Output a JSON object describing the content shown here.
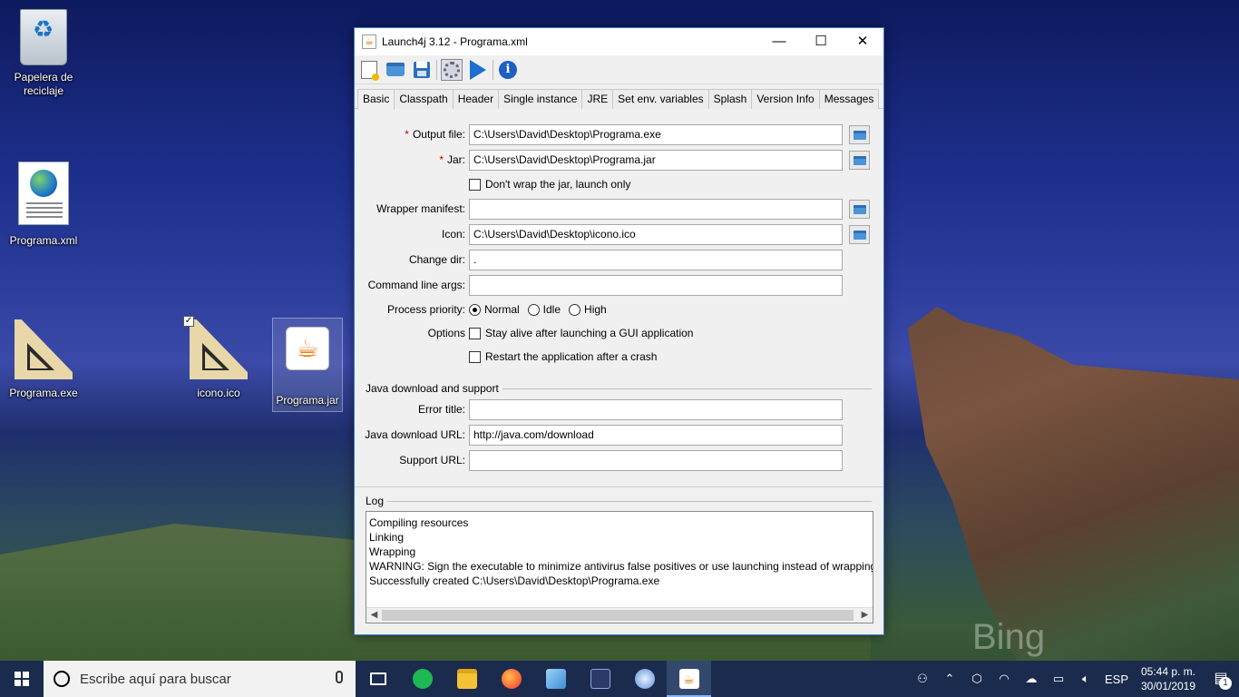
{
  "desktop": {
    "icons": [
      {
        "label": "Papelera de reciclaje"
      },
      {
        "label": "Programa.xml"
      },
      {
        "label": "Programa.exe"
      },
      {
        "label": "icono.ico"
      },
      {
        "label": "Programa.jar"
      }
    ],
    "watermark": "Bing"
  },
  "window": {
    "title": "Launch4j 3.12 - Programa.xml",
    "controls": {
      "minimize": "—",
      "maximize": "☐",
      "close": "✕"
    },
    "toolbar": [
      "new-icon",
      "open-icon",
      "save-icon",
      "build-gear-icon",
      "run-icon",
      "info-icon"
    ],
    "tabs": [
      "Basic",
      "Classpath",
      "Header",
      "Single instance",
      "JRE",
      "Set env. variables",
      "Splash",
      "Version Info",
      "Messages"
    ],
    "active_tab": "Basic",
    "form": {
      "output_file": {
        "label": "Output file:",
        "value": "C:\\Users\\David\\Desktop\\Programa.exe",
        "required": "*"
      },
      "jar": {
        "label": "Jar:",
        "value": "C:\\Users\\David\\Desktop\\Programa.jar",
        "required": "*"
      },
      "dont_wrap": {
        "label": "Don't wrap the jar, launch only"
      },
      "wrapper_manifest": {
        "label": "Wrapper manifest:",
        "value": ""
      },
      "icon": {
        "label": "Icon:",
        "value": "C:\\Users\\David\\Desktop\\icono.ico"
      },
      "change_dir": {
        "label": "Change dir:",
        "value": "."
      },
      "cmd_args": {
        "label": "Command line args:",
        "value": ""
      },
      "priority": {
        "label": "Process priority:",
        "options": [
          "Normal",
          "Idle",
          "High"
        ],
        "selected": "Normal"
      },
      "options": {
        "label": "Options",
        "stay_alive": "Stay alive after launching a GUI application",
        "restart": "Restart the application after a crash"
      },
      "java_section": "Java download and support",
      "error_title": {
        "label": "Error title:",
        "value": ""
      },
      "java_url": {
        "label": "Java download URL:",
        "value": "http://java.com/download"
      },
      "support_url": {
        "label": "Support URL:",
        "value": ""
      }
    },
    "log": {
      "title": "Log",
      "lines": [
        "Compiling resources",
        "Linking",
        "Wrapping",
        "WARNING: Sign the executable to minimize antivirus false positives or use launching instead of wrapping.",
        "Successfully created C:\\Users\\David\\Desktop\\Programa.exe"
      ]
    }
  },
  "taskbar": {
    "search_placeholder": "Escribe aquí para buscar",
    "apps": [
      "task-view-icon",
      "spotify-icon",
      "file-explorer-icon",
      "firefox-icon",
      "3d-box-icon",
      "code-editor-icon",
      "weather-app-icon",
      "java-launch4j-icon"
    ],
    "lang": "ESP",
    "time": "05:44 p. m.",
    "date": "30/01/2019",
    "notifications": "1"
  }
}
